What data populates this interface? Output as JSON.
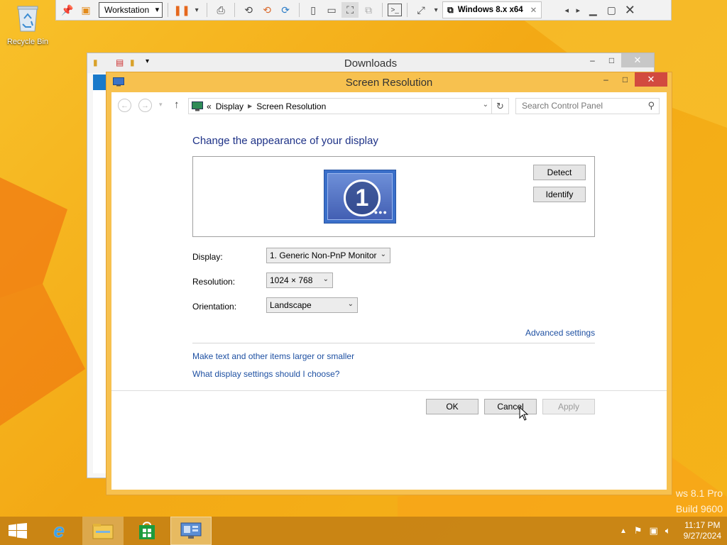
{
  "desktop": {
    "recycle_bin_label": "Recycle Bin",
    "watermark_line1": "ws 8.1 Pro",
    "watermark_line2": "Build 9600"
  },
  "vm_toolbar": {
    "library_select": "Workstation",
    "vm_tab_label": "Windows 8.x x64",
    "icons": [
      "pin-icon",
      "unity-icon",
      "pause-icon",
      "send-keys-icon",
      "snapshot-icon",
      "revert-icon",
      "snapshot-manager-icon",
      "hide-library-icon",
      "console-view-icon",
      "fullscreen-icon",
      "unity-mode-icon",
      "terminal-icon",
      "stretch-icon",
      "previous-tab-icon",
      "next-tab-icon",
      "minimize-icon",
      "restore-icon",
      "close-icon"
    ]
  },
  "downloads_window": {
    "title": "Downloads"
  },
  "screen_resolution": {
    "title": "Screen Resolution",
    "breadcrumb": {
      "prefix": "«",
      "items": [
        "Display",
        "Screen Resolution"
      ]
    },
    "search_placeholder": "Search Control Panel",
    "heading": "Change the appearance of your display",
    "monitor_number": "1",
    "detect_label": "Detect",
    "identify_label": "Identify",
    "display_label": "Display:",
    "display_value": "1. Generic Non-PnP Monitor",
    "resolution_label": "Resolution:",
    "resolution_value": "1024 × 768",
    "orientation_label": "Orientation:",
    "orientation_value": "Landscape",
    "advanced_link": "Advanced settings",
    "link_text_size": "Make text and other items larger or smaller",
    "link_what_settings": "What display settings should I choose?",
    "ok_label": "OK",
    "cancel_label": "Cancel",
    "apply_label": "Apply"
  },
  "taskbar": {
    "items": [
      "start",
      "internet-explorer",
      "file-explorer",
      "store",
      "control-panel"
    ],
    "clock_time": "11:17 PM",
    "clock_date": "9/27/2024"
  }
}
